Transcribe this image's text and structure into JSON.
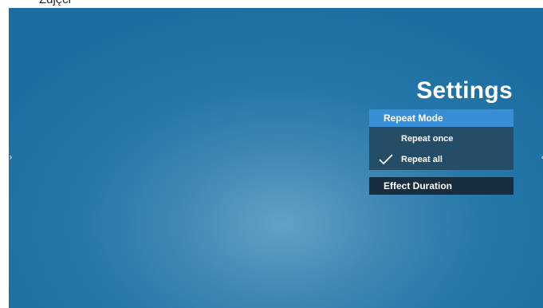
{
  "caption": "Zdjęci",
  "nav": {
    "left_arrow": "›",
    "right_arrow": "‹"
  },
  "settings": {
    "title": "Settings",
    "repeat_mode": {
      "label": "Repeat Mode",
      "options": [
        {
          "label": "Repeat once",
          "selected": false
        },
        {
          "label": "Repeat all",
          "selected": true
        }
      ]
    },
    "effect_duration": {
      "label": "Effect Duration"
    }
  },
  "colors": {
    "highlight": "#3a8ed6",
    "submenu_bg": "#244d68",
    "item_bg": "#182d3d",
    "screen_bg": "#2678aa"
  }
}
